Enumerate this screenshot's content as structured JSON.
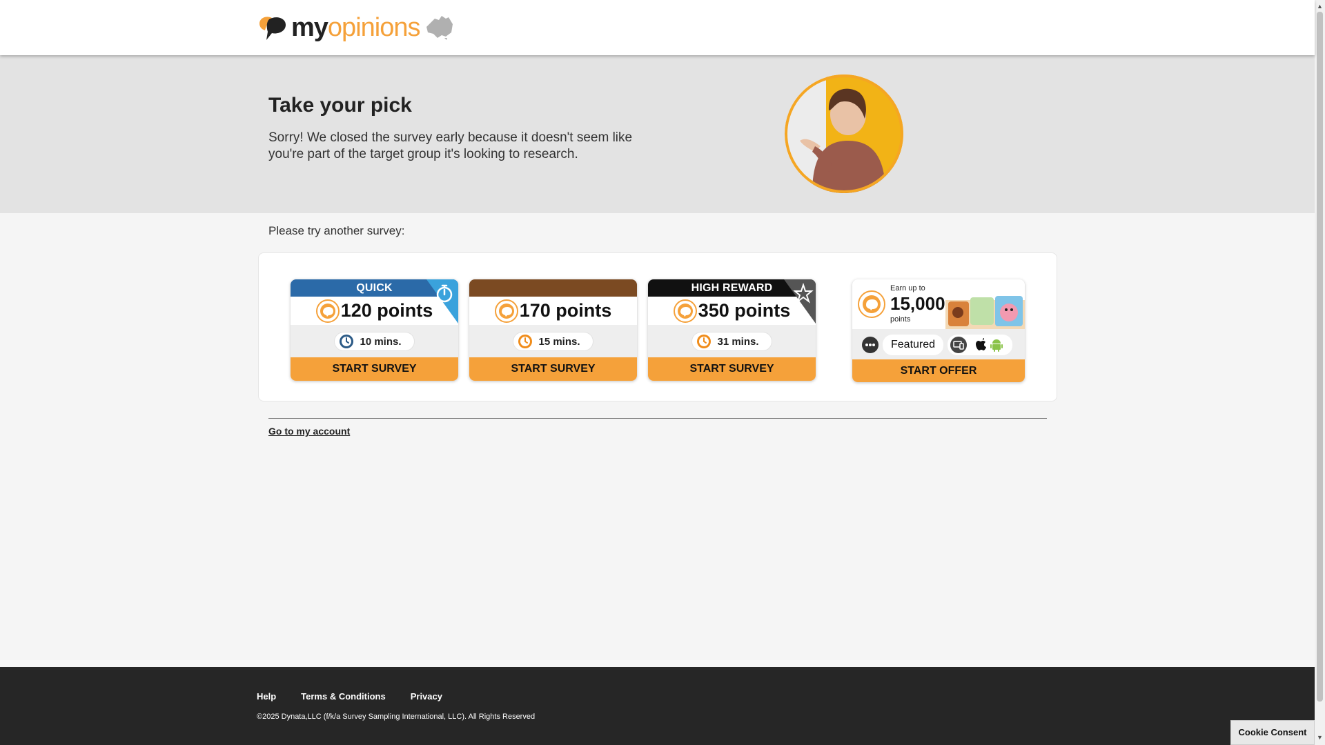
{
  "header": {
    "logo": {
      "my": "my",
      "opinions": "opinions"
    }
  },
  "hero": {
    "title": "Take your pick",
    "message": "Sorry! We closed the survey early because it doesn't seem like you're part of the target group it's looking to research."
  },
  "prompt": "Please try another survey:",
  "surveys": [
    {
      "badge": "QUICK",
      "points": "120 points",
      "duration": "10 mins.",
      "button": "START SURVEY",
      "badge_color": "#2b6aa8"
    },
    {
      "badge": "",
      "points": "170 points",
      "duration": "15 mins.",
      "button": "START SURVEY",
      "badge_color": "#7b4a22"
    },
    {
      "badge": "HIGH REWARD",
      "points": "350 points",
      "duration": "31 mins.",
      "button": "START SURVEY",
      "badge_color": "#111111"
    }
  ],
  "offer": {
    "earn_label": "Earn up to",
    "amount": "15,000",
    "unit": "points",
    "tag": "Featured",
    "button": "START OFFER"
  },
  "account_link": "Go to my account",
  "footer": {
    "links": [
      "Help",
      "Terms & Conditions",
      "Privacy"
    ],
    "copyright": "©2025 Dynata,LLC (f/k/a Survey Sampling International, LLC). All Rights Reserved"
  },
  "cookie_button": "Cookie Consent",
  "colors": {
    "accent": "#f5a13a",
    "footer": "#262626",
    "hero_bg": "#e3e3e3"
  }
}
